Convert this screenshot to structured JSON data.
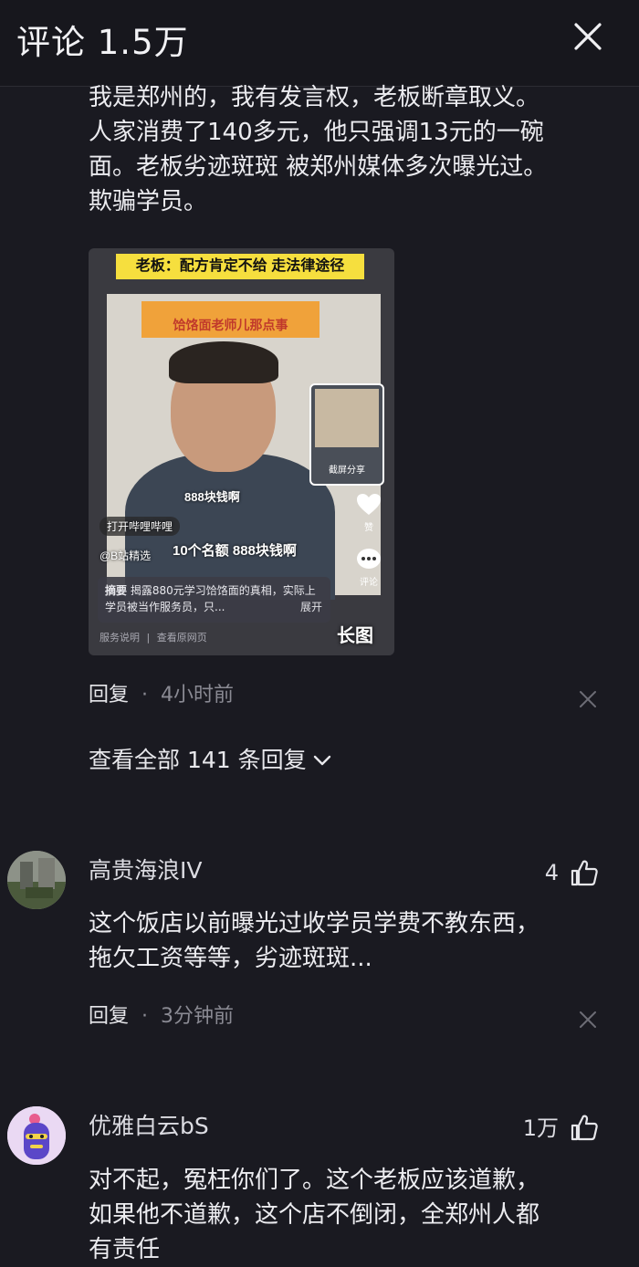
{
  "header": {
    "title": "评论 1.5万"
  },
  "comment1": {
    "lines": [
      "我是郑州的，我有发言权，老板断章取义。",
      "人家消费了140多元，他只强调13元的一碗",
      "面。老板劣迹斑斑 被郑州媒体多次曝光过。",
      "欺骗学员。"
    ],
    "image": {
      "banner": "老板：配方肯定不给 走法律途径",
      "sign": "饸饹面老师儿那点事",
      "caption1": "888块钱啊",
      "caption2": "10个名额 888块钱啊",
      "open_app": "打开哔哩哔哩",
      "source": "@B站精选",
      "pip_label": "截屏分享",
      "like_label": "赞",
      "comment_label": "评论",
      "ai_title": "摘要",
      "ai_summary": "揭露880元学习饸饹面的真相，实际上学员被当作服务员，只...",
      "ai_expand": "展开",
      "footer_service": "服务说明",
      "footer_view": "查看原网页",
      "long_tag": "长图"
    },
    "reply_label": "回复",
    "time": "4小时前"
  },
  "view_all": "查看全部 141 条回复",
  "comment2": {
    "username": "高贵海浪IV",
    "likes": "4",
    "lines": [
      "这个饭店以前曝光过收学员学费不教东西，",
      "拖欠工资等等，劣迹斑斑..."
    ],
    "reply_label": "回复",
    "time": "3分钟前"
  },
  "comment3": {
    "username": "优雅白云bS",
    "likes": "1万",
    "lines": [
      "对不起，冤枉你们了。这个老板应该道歉，",
      "如果他不道歉，这个店不倒闭，全郑州人都",
      "有责任"
    ]
  }
}
